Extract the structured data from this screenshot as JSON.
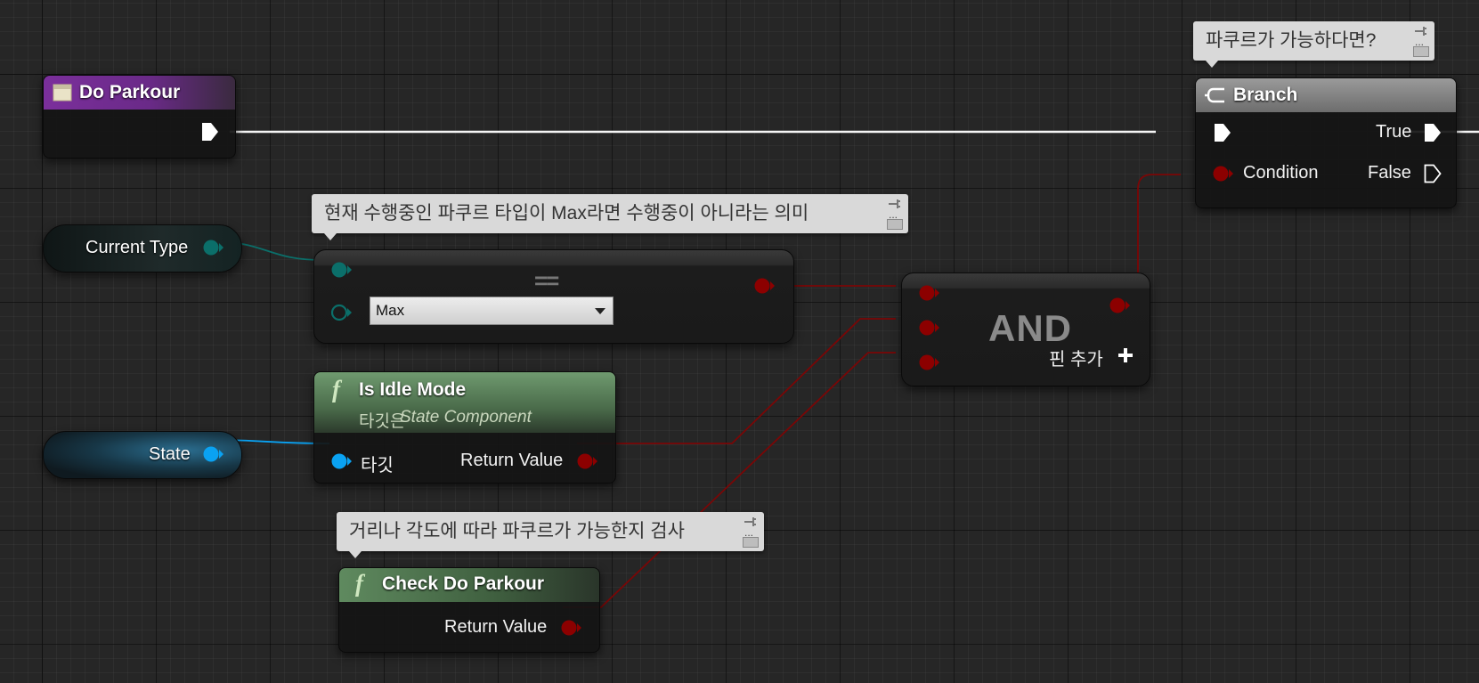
{
  "nodes": {
    "do_parkour": {
      "title": "Do Parkour",
      "icon": "event-icon",
      "color": "#7b2f9c"
    },
    "branch": {
      "title": "Branch",
      "icon": "branch-icon",
      "pins": {
        "condition": "Condition",
        "true": "True",
        "false": "False"
      }
    },
    "current_type": {
      "label": "Current Type"
    },
    "state": {
      "label": "State"
    },
    "equal": {
      "operator": "==",
      "enum_value": "Max"
    },
    "is_idle_mode": {
      "title": "Is Idle Mode",
      "subtitle_prefix": "타깃은",
      "subtitle_class": "State Component",
      "pins": {
        "target": "타깃",
        "return": "Return Value"
      }
    },
    "and": {
      "title": "AND",
      "add_pin": "핀 추가",
      "add_icon": "plus-icon"
    },
    "check_do_parkour": {
      "title": "Check Do Parkour",
      "pins": {
        "return": "Return Value"
      }
    }
  },
  "comments": {
    "branch": "파쿠르가 가능하다면?",
    "equal": "현재 수행중인 파쿠르 타입이 Max라면 수행중이 아니라는 의미",
    "check_do_parkour": "거리나 각도에 따라 파쿠르가 가능한지 검사"
  },
  "colors": {
    "exec": "#ffffff",
    "bool": "#8c0000",
    "enum": "#0b6f6a",
    "object": "#0aa2f2",
    "function_header": "#5f8a5f",
    "branch_header": "#8a8a8a"
  }
}
